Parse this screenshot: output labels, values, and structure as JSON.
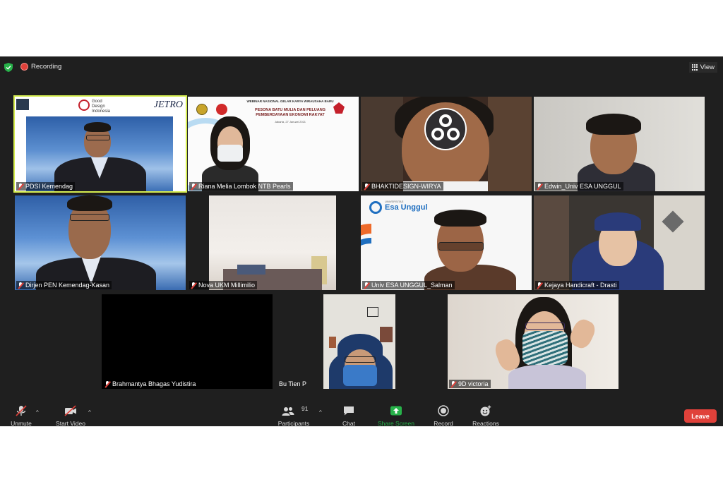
{
  "topbar": {
    "recording_label": "Recording",
    "view_label": "View"
  },
  "tiles": {
    "t1": {
      "name": "PDSI Kemendag",
      "logo1": "Good Design Indonesia",
      "logo2": "JETRO"
    },
    "t2": {
      "name": "Riana Melia Lombok NTB Pearls",
      "banner_title": "WEBINAR NASIONAL GELAR KARYA WIRAUSAHA BARU",
      "banner_sub": "PESONA BATU MULIA DAN PELUANG PEMBERDAYAAN EKONOMI RAKYAT",
      "banner_date": "Jakarta, 27 Januari 2021"
    },
    "t3": {
      "name": "BHAKTIDESIGN-WIRYA"
    },
    "t4": {
      "name": "Edwin_Univ ESA UNGGUL"
    },
    "t5": {
      "name": "Dirjen PEN Kemendag-Kasan"
    },
    "t6": {
      "name": "Nova UKM Millimilio"
    },
    "t7": {
      "name": "Univ ESA UNGGUL_Salman",
      "logo_text": "Esa Unggul",
      "logo_pre": "UNIVERSITAS"
    },
    "t8": {
      "name": "Kejaya Handicraft - Drasti"
    },
    "t9": {
      "name": "Brahmantya Bhagas Yudistira"
    },
    "t10": {
      "name": "Bu Tien P"
    },
    "t11": {
      "name": "9D victoria"
    }
  },
  "toolbar": {
    "unmute": "Unmute",
    "start_video": "Start Video",
    "participants": "Participants",
    "participants_count": "91",
    "chat": "Chat",
    "share_screen": "Share Screen",
    "record": "Record",
    "reactions": "Reactions",
    "leave": "Leave"
  },
  "colors": {
    "share_green": "#27b24a",
    "leave_red": "#e0413a",
    "active_speaker": "#d6ee4f"
  }
}
